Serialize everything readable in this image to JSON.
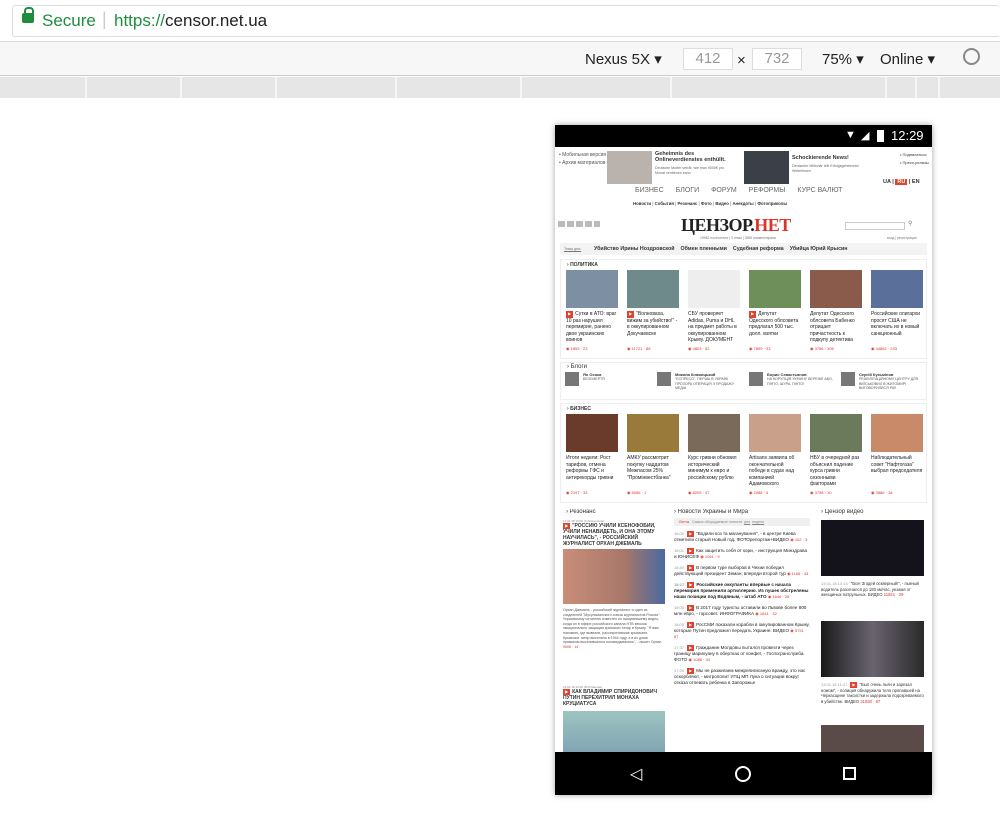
{
  "browser": {
    "secure_label": "Secure",
    "url_scheme": "https://",
    "url_host": "censor.net.ua"
  },
  "devtools": {
    "device": "Nexus 5X",
    "width": "412",
    "height": "732",
    "times": "×",
    "zoom": "75%",
    "network": "Online"
  },
  "phone": {
    "time": "12:29",
    "top_links": [
      "Мобильная версия",
      "Архив материалов"
    ],
    "right_links": [
      "Подписаться",
      "Пресс-релизы"
    ],
    "ads": [
      {
        "title": "Geheimnis des Onlineverdienstes enthüllt.",
        "desc": "Deutsche Mutter verrät, wie man 9000€ pro Monat verdienen kann"
      },
      {
        "title": "Schockierende News!",
        "desc": "Deutscher Millionär teilt Erfolgsgeheimnis! Weiterlesen"
      }
    ],
    "languages": [
      "UA",
      "RU",
      "EN"
    ],
    "menu": [
      "БИЗНЕС",
      "БЛОГИ",
      "ФОРУМ",
      "РЕФОРМЫ",
      "КУРС ВАЛЮТ"
    ],
    "subnav": [
      "Новости",
      "События",
      "Резонанс",
      "Фото",
      "Видео",
      "Анекдоты",
      "Фотоприколы"
    ],
    "logo": {
      "part1": "ЦЕНЗОР.",
      "part2": "НЕТ",
      "stats": "19982 посетителя | 3 темы | 3555 комментариев"
    },
    "login": "вход | регистрация",
    "topics_label": "Темы дня:",
    "topics": [
      "Убийство Ирины Ноздровской",
      "Обмен пленными",
      "Судебная реформа",
      "Убийца Юрий Крысин"
    ],
    "politics": {
      "title": "ПОЛИТИКА",
      "items": [
        {
          "text": "Сутки в АТО: враг 10 раз нарушил перемирие, ранено двое украинских воинов",
          "stats": "1853 · 23",
          "tag": true,
          "color": "#7c8fa3"
        },
        {
          "text": "\"Волноваха, вижим за убийство!\" - в оккупированном Докучаевске",
          "stats": "11721 · 88",
          "tag": true,
          "color": "#6e8a8a"
        },
        {
          "text": "СБУ проверяет Adidas, Puma и DHL на предмет работы в оккупированном Крыму. ДОКУМЕНТ",
          "stats": "4803 · 52",
          "tag": false,
          "color": "#eeeeee"
        },
        {
          "text": "Депутат Одесского облсовета предлагал 500 тыс. долл. взятки",
          "stats": "7899 · 33",
          "tag": true,
          "color": "#6f8f5a"
        },
        {
          "text": "Депутат Одесского облсовета Бабенко отрицает причастность к подкупу детектива",
          "stats": "3756 · 105",
          "tag": false,
          "color": "#8a5a4a"
        },
        {
          "text": "Российские олигархи просят США не включать их в новый санкционный",
          "stats": "44882 · 233",
          "tag": false,
          "color": "#5a6f9a"
        }
      ]
    },
    "blogs": {
      "title": "Блоги",
      "items": [
        {
          "author": "Ян Осока",
          "text": "БЕЗСМЕРТЯ"
        },
        {
          "author": "Микола Княжицький",
          "text": "\"ЕСПРЕСО\". ПЕРША В УКРАЇНІ ПРОЗОРА ОПЕРАЦІЯ З ПРОДАЖУ МЕДІА"
        },
        {
          "author": "Борис Севастьянов",
          "text": "НА КОРУПЦІЯ УКРАЇНУ БЕРЕЖЕ АБО, ПІНТО, ШУРА, ПІНТО!"
        },
        {
          "author": "Сергій Кузьмінов",
          "text": "РЕАБІЛІТАЦІЙНОМУ ЦЕНТРУ ДЛЯ ВІЙСЬКОВИХ В ЖИТОМИРІ ВИГОВОРИЛИСЯ РІК!"
        }
      ]
    },
    "business": {
      "title": "БИЗНЕС",
      "items": [
        {
          "text": "Итоги недели: Рост тарифов, отмена реформы ГФС и антирекорды гривни",
          "stats": "2197 · 33",
          "color": "#6a3a2a"
        },
        {
          "text": "АМКУ рассмотрит покупку наддатом Межпасом 25% \"Промінвестбанка\"",
          "stats": "5056 · 1",
          "color": "#9a7a3a"
        },
        {
          "text": "Курс гривни обновил исторический минимум к евро и российскому рублю",
          "stats": "8205 · 47",
          "color": "#7a6a5a"
        },
        {
          "text": "Artisans заявила об окончательной победе в судах над компанией Адамовского",
          "stats": "2088 · 5",
          "color": "#c9a08a"
        },
        {
          "text": "НБУ в очередной раз объяснил падение курса гривни сезонными факторами",
          "stats": "3798 · 10",
          "color": "#6a7a5a"
        },
        {
          "text": "Наблюдательный совет \"Нафтогаза\" выбрал председателя",
          "stats": "3886 · 18",
          "color": "#c98a6a"
        }
      ]
    },
    "resonance": {
      "title": "Резонанс",
      "items": [
        {
          "date": "13.01.18 13:00 (Vi Ruinovanie)",
          "headline": "\"РОССИЮ УЧИЛИ КСЕНОФОБИИ, УЧИЛИ НЕНАВИДЕТЬ, И ОНА ЭТОМУ НАУЧИЛАСЬ\", - РОССИЙСКИЙ ЖУРНАЛИСТ ОРХАН ДЖЕМАЛЬ",
          "body": "Орхан Джемаль - российский журналист и один из создателей \"Мусульманского союза журналистов России\". Украинскому читателю известен по нашумевшему видео, когда он в эфире российского канала НТВ весьма эмоционально защищал крымских татар в Крыму. \"Я вам напомню, где вывезли, рассекретившие крымчане. Крымских татар выселяли в 1944 году, а в их дома прямиком выселившихся понаведывались\", - пишет Орхан",
          "stats": "9008 · 14"
        },
        {
          "date": "13.01.18 13:00 (B.Рубанова)",
          "headline": "КАК ВЛАДИМИР СПИРИДОНОВИЧ ПУТИН ПЕРЕХИТРИЛ МОНАХА КРУЦИАТУСА"
        }
      ]
    },
    "news": {
      "title": "Новости Украины и Мира",
      "tabs": [
        "Лента",
        "Самые обсуждаемые новости",
        "дня",
        "недели"
      ],
      "items": [
        {
          "time": "18:00",
          "text": "\"Водили коз та маганування\", - в центре Киева отметили старый Новый год. ФОТОрепортаж+ВИДЕО",
          "stats": "102 · 3",
          "bold": false
        },
        {
          "time": "18:01",
          "text": "Как защитить себя от кори, - инструкция Минздрава и ЮНИСЕФ",
          "stats": "1061 · 9",
          "bold": false
        },
        {
          "time": "18:40",
          "text": "В первом туре выборов в Чехии победил действующий президент Земан; впереди второй тур",
          "stats": "1165 · 43",
          "bold": false
        },
        {
          "time": "18:17",
          "text": "Российские оккупанты впервые с начала перемирия применили артиллерию. Из пушек обстреляны наши позиции под Водяным, - штаб АТО",
          "stats": "1646 · 28",
          "bold": true
        },
        {
          "time": "18:00",
          "text": "В 2017 году туристы оставили во Львове более 800 млн евро, - горсовет. ИНФОГРАФИКА",
          "stats": "1641 · 32",
          "bold": false
        },
        {
          "time": "18:00",
          "text": "РосСМИ показали корабли в оккупированном Крыму, которые Путин предложил передать Украине. ВИДЕО",
          "stats": "5751 · 67",
          "bold": false
        },
        {
          "time": "17:37",
          "text": "Гражданин Молдовы пытался провезти через границу марихуану в обертках от конфет, - Госпогранслужба. ФОТО",
          "stats": "1086 · 34",
          "bold": false
        },
        {
          "time": "17:29",
          "text": "Мы не разжигаем межрелигиозную вражду, это нас оскорбляют, - митрополит УПЦ МП Лука о ситуации вокруг отказа отпевать ребенка в Запорожье",
          "stats": "",
          "bold": false
        }
      ]
    },
    "video": {
      "title": "Цензор видео",
      "items": [
        {
          "date": "13.01.18 13:14",
          "text": "\"Все! Згодей оскверный!\", - пьяный водитель разогнался до 180 км/час, уезжая от женщиных патрульных. ВИДЕО",
          "stats": "11821 · 29"
        },
        {
          "date": "13.01.18 11:27",
          "text": "\"Был очень пьян и зарезал ножом\", - полиция обнаружила тело пропавшей на Черкасщине таксистки и задержала подозреваемого в убийстве. ВИДЕО",
          "stats": "31930 · 87"
        }
      ]
    }
  },
  "colors": {
    "accent": "#d9352b",
    "secure": "#1e8e3e"
  }
}
